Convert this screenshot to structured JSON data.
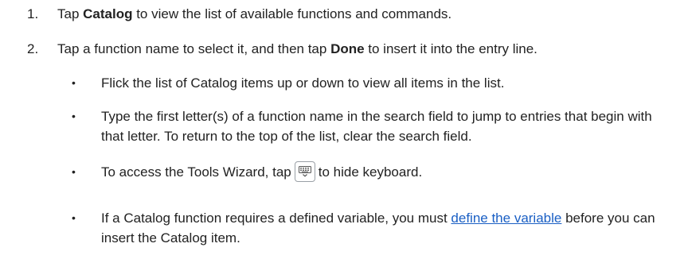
{
  "steps": [
    {
      "number": "1.",
      "pre": "Tap ",
      "bold": "Catalog",
      "post": " to view the list of available functions and commands."
    },
    {
      "number": "2.",
      "pre": "Tap a function name to select it, and then tap ",
      "bold": "Done",
      "post": " to insert it into the entry line."
    }
  ],
  "bullets": [
    {
      "symbol": "•",
      "text": "Flick the list of Catalog items up or down to view all items in the list."
    },
    {
      "symbol": "•",
      "text": "Type the first letter(s) of a function name in the search field to jump to entries that begin with that letter. To return to the top of the list, clear the search field."
    },
    {
      "symbol": "•",
      "pre": "To access the Tools Wizard, tap",
      "icon": "hide-keyboard-icon",
      "post": "to hide keyboard."
    },
    {
      "symbol": "•",
      "pre": "If a Catalog function requires a defined variable, you must ",
      "link": "define the variable",
      "post": " before you can insert the Catalog item."
    }
  ],
  "colors": {
    "text": "#222222",
    "link": "#1a5fc4"
  }
}
